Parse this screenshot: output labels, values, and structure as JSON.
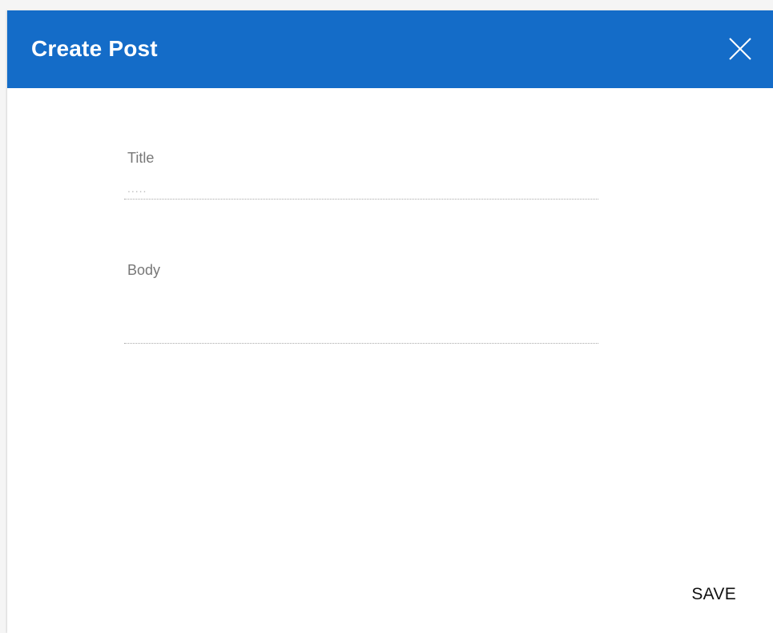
{
  "dialog": {
    "title": "Create Post",
    "close_icon": "close-icon",
    "header_color": "#146cc8"
  },
  "form": {
    "title_field": {
      "label": "Title",
      "value": "",
      "placeholder": "....."
    },
    "body_field": {
      "label": "Body",
      "value": "",
      "placeholder": ""
    }
  },
  "actions": {
    "save_label": "SAVE"
  }
}
